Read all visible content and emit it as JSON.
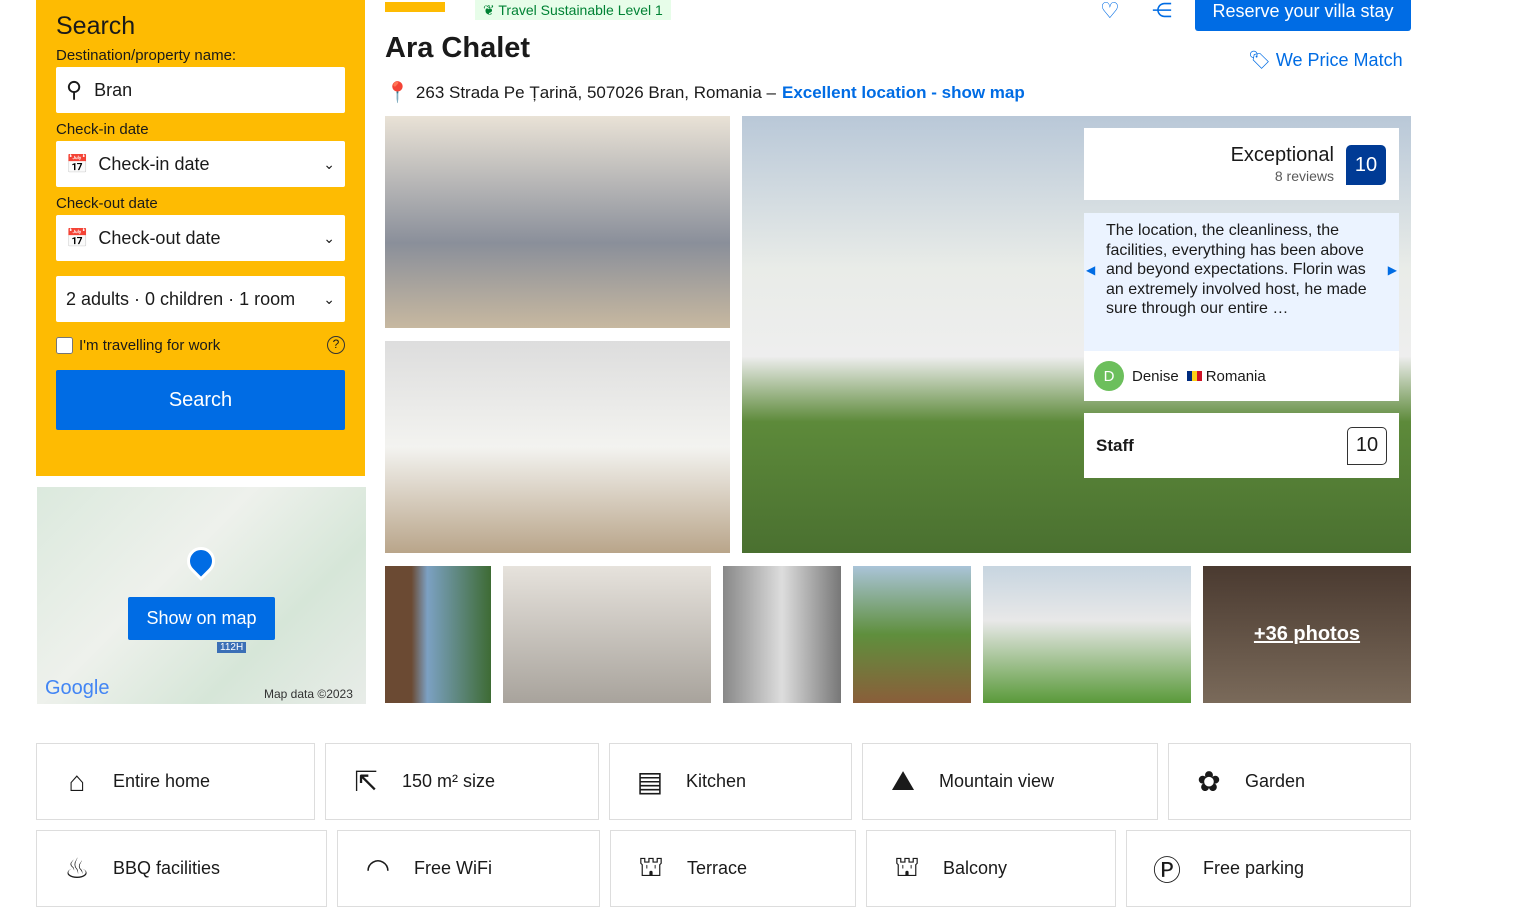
{
  "search": {
    "title": "Search",
    "dest_label": "Destination/property name:",
    "dest_value": "Bran",
    "checkin_label": "Check-in date",
    "checkin_value": "Check-in date",
    "checkout_label": "Check-out date",
    "checkout_value": "Check-out date",
    "guests": "2 adults · 0 children · 1 room",
    "work_label": "I'm travelling for work",
    "button": "Search"
  },
  "map": {
    "button": "Show on map",
    "road": "112H",
    "logo": "Google",
    "credit": "Map data ©2023"
  },
  "header": {
    "badge": "Travel Sustainable Level 1",
    "title": "Ara Chalet",
    "address": "263 Strada Pe Țarină, 507026 Bran, Romania –",
    "location_link": "Excellent location - show map",
    "reserve": "Reserve your villa stay",
    "price_match": "We Price Match"
  },
  "review": {
    "label": "Exceptional",
    "count": "8 reviews",
    "score": "10",
    "text": "The location, the cleanliness, the facilities, everything has been above and beyond expectations. Florin was an extremely involved host, he made sure through our entire …",
    "avatar": "D",
    "reviewer": "Denise",
    "country": "Romania",
    "staff_label": "Staff",
    "staff_score": "10"
  },
  "gallery": {
    "more": "+36 photos"
  },
  "amenities": [
    {
      "label": "Entire home",
      "icon": "house-icon"
    },
    {
      "label": "150 m² size",
      "icon": "size-icon"
    },
    {
      "label": "Kitchen",
      "icon": "kitchen-icon"
    },
    {
      "label": "Mountain view",
      "icon": "mountain-icon"
    },
    {
      "label": "Garden",
      "icon": "garden-icon"
    },
    {
      "label": "BBQ facilities",
      "icon": "bbq-icon"
    },
    {
      "label": "Free WiFi",
      "icon": "wifi-icon"
    },
    {
      "label": "Terrace",
      "icon": "terrace-icon"
    },
    {
      "label": "Balcony",
      "icon": "balcony-icon"
    },
    {
      "label": "Free parking",
      "icon": "parking-icon"
    }
  ],
  "colors": {
    "accent": "#006ce4",
    "sidebar": "#febb02",
    "score": "#003b95"
  }
}
